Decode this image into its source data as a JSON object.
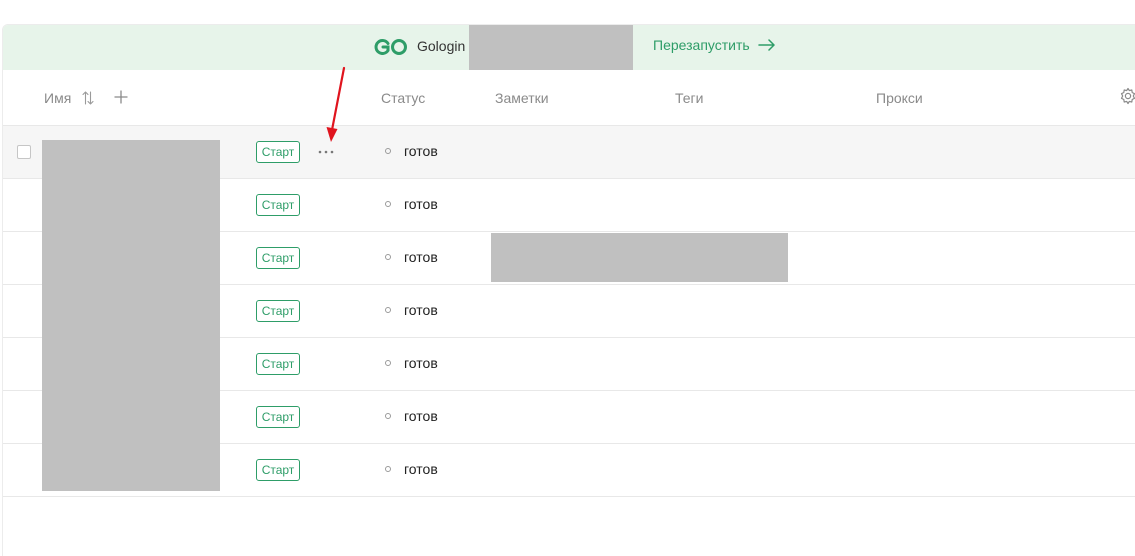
{
  "banner": {
    "brand": "Gologin",
    "restart_label": "Перезапустить"
  },
  "table": {
    "columns": {
      "name": "Имя",
      "status": "Статус",
      "notes": "Заметки",
      "tags": "Теги",
      "proxy": "Прокси"
    },
    "rows": [
      {
        "start_label": "Старт",
        "status": "готов"
      },
      {
        "start_label": "Старт",
        "status": "готов"
      },
      {
        "start_label": "Старт",
        "status": "готов"
      },
      {
        "start_label": "Старт",
        "status": "готов"
      },
      {
        "start_label": "Старт",
        "status": "готов"
      },
      {
        "start_label": "Старт",
        "status": "готов"
      },
      {
        "start_label": "Старт",
        "status": "готов"
      }
    ]
  },
  "colors": {
    "accent": "#2e9d68",
    "banner_bg": "#e7f4ea",
    "annotation_arrow": "#e0141e"
  }
}
